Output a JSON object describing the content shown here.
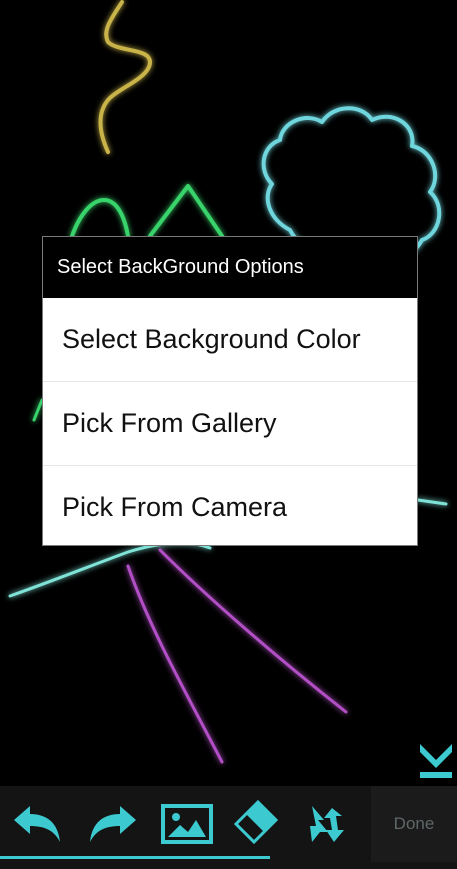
{
  "dialog": {
    "title": "Select BackGround Options",
    "options": [
      "Select Background Color",
      "Pick From Gallery",
      "Pick From Camera"
    ]
  },
  "toolbar": {
    "tools": [
      {
        "icon": "undo-icon"
      },
      {
        "icon": "redo-icon"
      },
      {
        "icon": "image-icon"
      },
      {
        "icon": "eraser-icon"
      },
      {
        "icon": "swap-icon"
      }
    ],
    "done_label": "Done"
  },
  "colors": {
    "accent": "#3cc9cf",
    "dialog_title_bg": "#000000",
    "dialog_bg": "#ffffff",
    "toolbar_bg": "#141414",
    "stroke_yellow": "#c9b44a",
    "stroke_cyan": "#6fd6dd",
    "stroke_green": "#39d36a",
    "stroke_purple": "#b24fc6",
    "stroke_teal": "#7fe3d8"
  }
}
